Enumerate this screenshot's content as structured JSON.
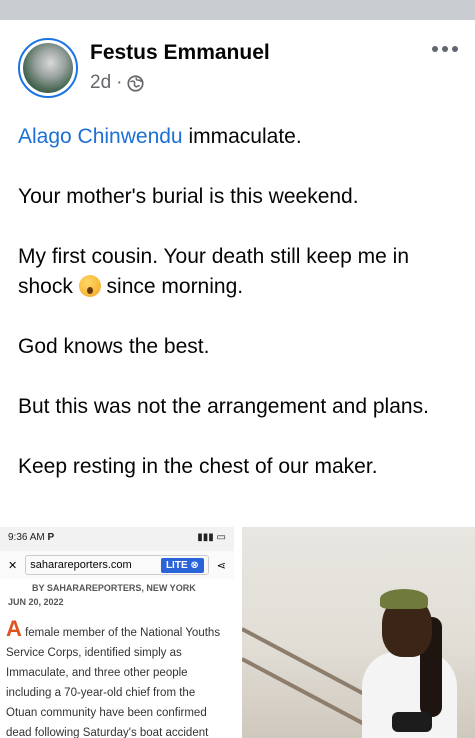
{
  "post": {
    "author": "Festus Emmanuel",
    "time": "2d",
    "separator": "·",
    "mention": "Alago Chinwendu",
    "paragraphs": {
      "p1_rest": " immaculate.",
      "p2": "Your mother's burial is this weekend.",
      "p3_a": "My first cousin. Your death still keep me in shock ",
      "p3_b": " since morning.",
      "p4": "God knows the best.",
      "p5": "But this was not the arrangement and plans.",
      "p6": "Keep resting in the chest of our maker."
    }
  },
  "screenshot": {
    "status_time": "9:36 AM",
    "status_letter": "P",
    "url": "saharareporters.com",
    "lite_label": "LITE ⊗",
    "byline": "BY SAHARAREPORTERS, NEW YORK",
    "date": "JUN 20, 2022",
    "dropcap": "A",
    "article_text": " female member of the National Youths Service Corps, identified simply as Immaculate, and three other people including a 70-year-old chief from the Otuan community have been confirmed dead following Saturday's boat accident"
  },
  "icons": {
    "globe": "globe-icon",
    "more": "more-options-icon",
    "close": "close-icon",
    "share": "share-icon",
    "emoji": "shocked-face-emoji"
  },
  "colors": {
    "link": "#1b6fd6",
    "meta": "#65676b",
    "avatar_ring": "#1b74e4"
  }
}
